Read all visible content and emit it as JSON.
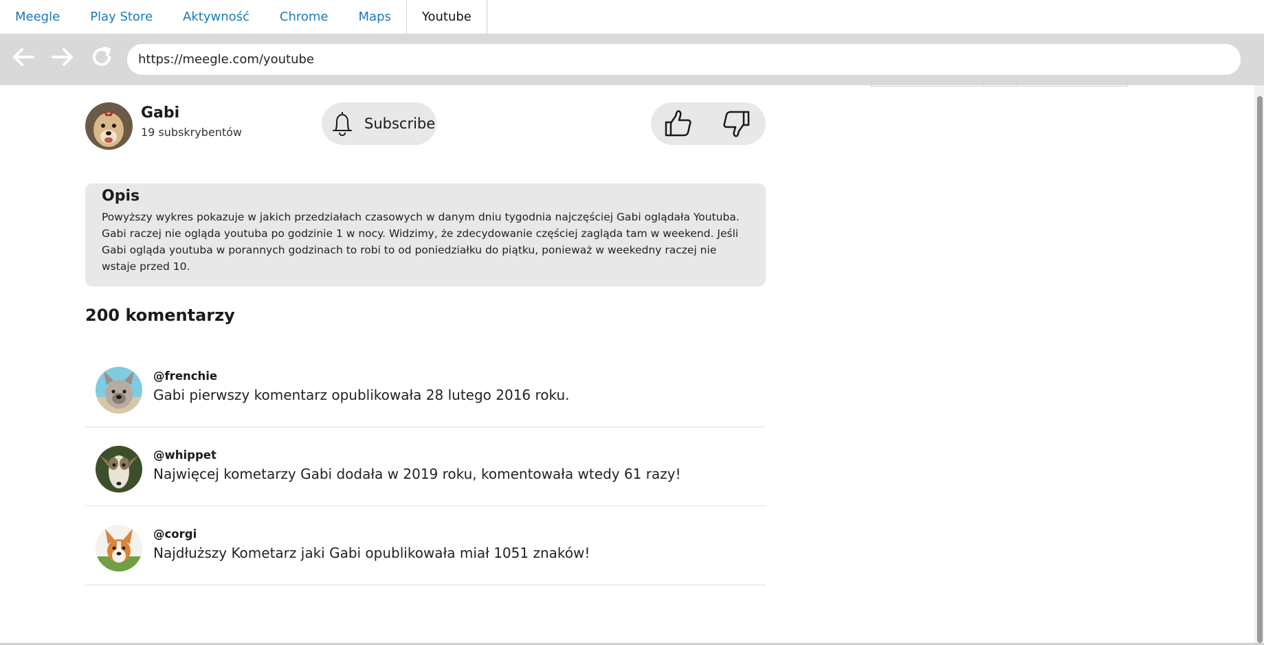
{
  "tabs": [
    {
      "label": "Meegle"
    },
    {
      "label": "Play Store"
    },
    {
      "label": "Aktywność"
    },
    {
      "label": "Chrome"
    },
    {
      "label": "Maps"
    },
    {
      "label": "Youtube",
      "active": true
    }
  ],
  "browser": {
    "url": "https://meegle.com/youtube",
    "back_icon": "arrow-left-icon",
    "forward_icon": "arrow-right-icon",
    "reload_icon": "reload-icon"
  },
  "channel": {
    "name": "Gabi",
    "subscribers": "19 subskrybentów",
    "avatar_icon": "dog-avatar"
  },
  "subscribe": {
    "label": "Subscribe",
    "icon": "bell-icon"
  },
  "reactions": {
    "like_icon": "thumbs-up-icon",
    "dislike_icon": "thumbs-down-icon"
  },
  "description": {
    "title": "Opis",
    "text": "Powyższy wykres pokazuje w jakich przedziałach czasowych w danym dniu tygodnia najczęściej Gabi oglądała Youtuba. Gabi raczej nie ogląda youtuba po godzinie 1 w nocy. Widzimy, że zdecydowanie częściej zagląda tam w weekend. Jeśli Gabi ogląda youtuba w porannych godzinach to robi to od poniedziałku do piątku, ponieważ w weekedny raczej nie wstaje przed 10."
  },
  "comments_header": "200 komentarzy",
  "comments": [
    {
      "user": "@frenchie",
      "text": "Gabi pierwszy komentarz opublikowała 28 lutego 2016 roku."
    },
    {
      "user": "@whippet",
      "text": "Najwięcej kometarzy Gabi dodała w 2019 roku, komentowała wtedy 61 razy!"
    },
    {
      "user": "@corgi",
      "text": "Najdłuższy Kometarz jaki Gabi opublikowała miał 1051 znaków!"
    }
  ],
  "colors": {
    "tab_link": "#1a7ab8",
    "nav_bg": "#d9d9d9",
    "card_bg": "#e8e8e8"
  }
}
